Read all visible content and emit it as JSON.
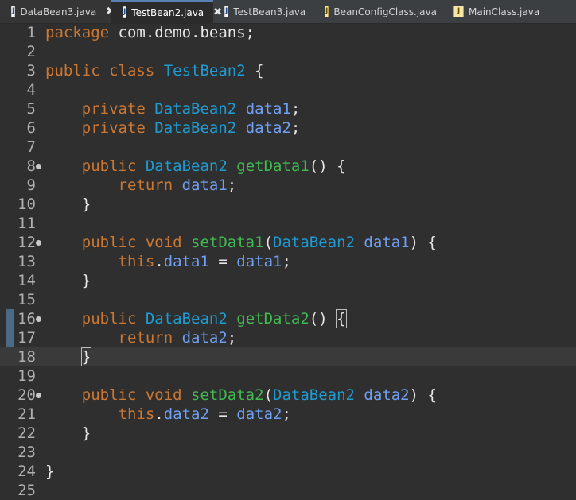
{
  "tabs": [
    {
      "label": "DataBean3.java",
      "icon": "java-file-icon",
      "closable": true,
      "active": false
    },
    {
      "label": "TestBean2.java",
      "icon": "java-file-icon",
      "closable": true,
      "active": true
    },
    {
      "label": "TestBean3.java",
      "icon": "java-file-icon",
      "closable": false,
      "active": false
    },
    {
      "label": "BeanConfigClass.java",
      "icon": "config-java-file-icon",
      "closable": false,
      "active": false
    },
    {
      "label": "MainClass.java",
      "icon": "config-java-file-icon",
      "closable": false,
      "active": false
    }
  ],
  "close_glyph": "✖",
  "editor": {
    "current_line": 18,
    "lines": [
      {
        "n": "1",
        "tokens": [
          [
            "kw",
            "package"
          ],
          [
            "pl",
            " com.demo.beans;"
          ]
        ]
      },
      {
        "n": "2",
        "tokens": []
      },
      {
        "n": "3",
        "tokens": [
          [
            "kw",
            "public class "
          ],
          [
            "ty",
            "TestBean2"
          ],
          [
            "pl",
            " {"
          ]
        ]
      },
      {
        "n": "4",
        "tokens": []
      },
      {
        "n": "5",
        "tokens": [
          [
            "pl",
            "    "
          ],
          [
            "kw",
            "private "
          ],
          [
            "ty",
            "DataBean2"
          ],
          [
            "pl",
            " "
          ],
          [
            "fi",
            "data1"
          ],
          [
            "pl",
            ";"
          ]
        ]
      },
      {
        "n": "6",
        "tokens": [
          [
            "pl",
            "    "
          ],
          [
            "kw",
            "private "
          ],
          [
            "ty",
            "DataBean2"
          ],
          [
            "pl",
            " "
          ],
          [
            "fi",
            "data2"
          ],
          [
            "pl",
            ";"
          ]
        ]
      },
      {
        "n": "7",
        "tokens": []
      },
      {
        "n": "8",
        "fold": true,
        "tokens": [
          [
            "pl",
            "    "
          ],
          [
            "kw",
            "public "
          ],
          [
            "ty",
            "DataBean2"
          ],
          [
            "pl",
            " "
          ],
          [
            "me",
            "getData1"
          ],
          [
            "pl",
            "() {"
          ]
        ]
      },
      {
        "n": "9",
        "tokens": [
          [
            "pl",
            "        "
          ],
          [
            "kw",
            "return "
          ],
          [
            "fi",
            "data1"
          ],
          [
            "pl",
            ";"
          ]
        ]
      },
      {
        "n": "10",
        "tokens": [
          [
            "pl",
            "    }"
          ]
        ]
      },
      {
        "n": "11",
        "tokens": []
      },
      {
        "n": "12",
        "fold": true,
        "tokens": [
          [
            "pl",
            "    "
          ],
          [
            "kw",
            "public void "
          ],
          [
            "me",
            "setData1"
          ],
          [
            "pl",
            "("
          ],
          [
            "ty",
            "DataBean2"
          ],
          [
            "pl",
            " "
          ],
          [
            "fi",
            "data1"
          ],
          [
            "pl",
            ") {"
          ]
        ]
      },
      {
        "n": "13",
        "tokens": [
          [
            "pl",
            "        "
          ],
          [
            "kw",
            "this"
          ],
          [
            "pl",
            "."
          ],
          [
            "fi",
            "data1"
          ],
          [
            "pl",
            " = "
          ],
          [
            "fi",
            "data1"
          ],
          [
            "pl",
            ";"
          ]
        ]
      },
      {
        "n": "14",
        "tokens": [
          [
            "pl",
            "    }"
          ]
        ]
      },
      {
        "n": "15",
        "tokens": []
      },
      {
        "n": "16",
        "fold": true,
        "tokens": [
          [
            "pl",
            "    "
          ],
          [
            "kw",
            "public "
          ],
          [
            "ty",
            "DataBean2"
          ],
          [
            "pl",
            " "
          ],
          [
            "me",
            "getData2"
          ],
          [
            "pl",
            "() "
          ],
          [
            "bracket",
            "{"
          ]
        ]
      },
      {
        "n": "17",
        "tokens": [
          [
            "pl",
            "        "
          ],
          [
            "kw",
            "return "
          ],
          [
            "fi",
            "data2"
          ],
          [
            "pl",
            ";"
          ]
        ]
      },
      {
        "n": "18",
        "tokens": [
          [
            "pl",
            "    "
          ],
          [
            "bracket",
            "}"
          ],
          [
            "caret",
            ""
          ]
        ]
      },
      {
        "n": "19",
        "tokens": []
      },
      {
        "n": "20",
        "fold": true,
        "tokens": [
          [
            "pl",
            "    "
          ],
          [
            "kw",
            "public void "
          ],
          [
            "me",
            "setData2"
          ],
          [
            "pl",
            "("
          ],
          [
            "ty",
            "DataBean2"
          ],
          [
            "pl",
            " "
          ],
          [
            "fi",
            "data2"
          ],
          [
            "pl",
            ") {"
          ]
        ]
      },
      {
        "n": "21",
        "tokens": [
          [
            "pl",
            "        "
          ],
          [
            "kw",
            "this"
          ],
          [
            "pl",
            "."
          ],
          [
            "fi",
            "data2"
          ],
          [
            "pl",
            " = "
          ],
          [
            "fi",
            "data2"
          ],
          [
            "pl",
            ";"
          ]
        ]
      },
      {
        "n": "22",
        "tokens": [
          [
            "pl",
            "    }"
          ]
        ]
      },
      {
        "n": "23",
        "tokens": []
      },
      {
        "n": "24",
        "tokens": [
          [
            "pl",
            "}"
          ]
        ]
      },
      {
        "n": "25",
        "tokens": []
      }
    ]
  },
  "colors": {
    "keyword": "#cc7832",
    "type": "#1f9bd1",
    "method": "#3fb950",
    "field": "#6f9ff0",
    "plain": "#e6e6e6",
    "background": "#2f2f2f"
  }
}
